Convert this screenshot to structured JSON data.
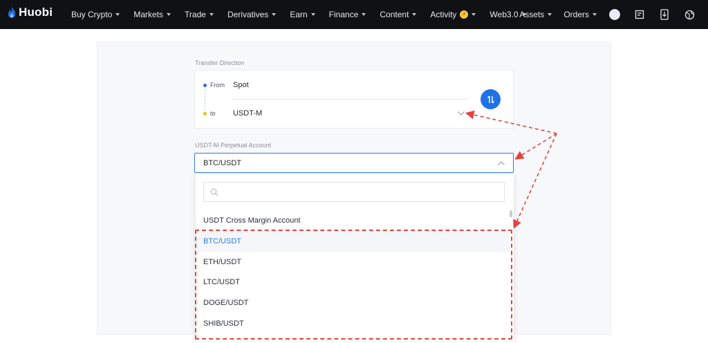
{
  "nav": {
    "logo_text": "Huobi",
    "items": [
      {
        "label": "Buy Crypto",
        "caret": true
      },
      {
        "label": "Markets",
        "caret": true
      },
      {
        "label": "Trade",
        "caret": true
      },
      {
        "label": "Derivatives",
        "caret": true
      },
      {
        "label": "Earn",
        "caret": true
      },
      {
        "label": "Finance",
        "caret": true
      },
      {
        "label": "Content",
        "caret": true
      },
      {
        "label": "Activity",
        "caret": true,
        "badge": true
      },
      {
        "label": "Web3.0",
        "caret": true
      }
    ],
    "right_items": [
      {
        "label": "Assets",
        "caret": true
      },
      {
        "label": "Orders",
        "caret": true
      }
    ],
    "icons": [
      "avatar",
      "order-icon",
      "download-icon",
      "globe-icon"
    ],
    "background": "#0f1115"
  },
  "transfer": {
    "section_label": "Transfer Direction",
    "from_label": "From",
    "from_value": "Spot",
    "to_label": "to",
    "to_value": "USDT-M",
    "from_dot_color": "#1f72e6",
    "to_dot_color": "#f0b90b",
    "swap_color": "#1f72e6"
  },
  "account": {
    "label": "USDT-M Perpetual Account",
    "selected_value": "BTC/USDT"
  },
  "dropdown": {
    "search_placeholder": "",
    "options": [
      {
        "label": "USDT Cross Margin Account",
        "selected": false
      },
      {
        "label": "BTC/USDT",
        "selected": true
      },
      {
        "label": "ETH/USDT",
        "selected": false
      },
      {
        "label": "LTC/USDT",
        "selected": false
      },
      {
        "label": "DOGE/USDT",
        "selected": false
      },
      {
        "label": "SHIB/USDT",
        "selected": false
      }
    ]
  },
  "annotation": {
    "color": "#e0453f"
  }
}
